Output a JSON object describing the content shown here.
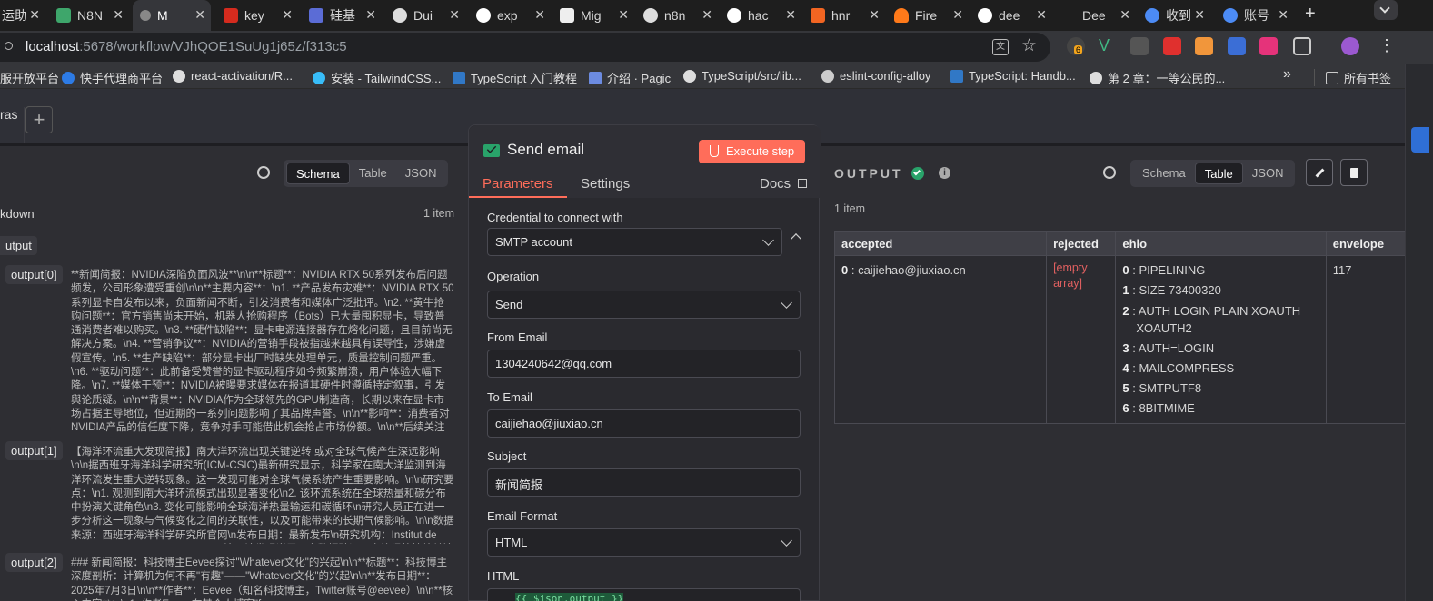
{
  "browser": {
    "tabs": [
      {
        "label": "运助"
      },
      {
        "label": "N8N"
      },
      {
        "label": "M"
      },
      {
        "label": "key"
      },
      {
        "label": "硅基"
      },
      {
        "label": "Dui"
      },
      {
        "label": "exp"
      },
      {
        "label": "Mig"
      },
      {
        "label": "n8n"
      },
      {
        "label": "hac"
      },
      {
        "label": "hnr"
      },
      {
        "label": "Fire"
      },
      {
        "label": "dee"
      },
      {
        "label": "Dee"
      },
      {
        "label": "收到"
      },
      {
        "label": "账号"
      }
    ],
    "new_tab": "+",
    "url_host": "localhost",
    "url_rest": ":5678/workflow/VJhQOE1SuUg1j65z/f313c5",
    "ext_badge": "6",
    "bookmarks": [
      {
        "label": "服开放平台"
      },
      {
        "label": "快手代理商平台"
      },
      {
        "label": "react-activation/R..."
      },
      {
        "label": "安装 - TailwindCSS..."
      },
      {
        "label": "TypeScript 入门教程"
      },
      {
        "label": "介绍 · Pagic"
      },
      {
        "label": "TypeScript/src/lib..."
      },
      {
        "label": "eslint-config-alloy"
      },
      {
        "label": "TypeScript: Handb..."
      },
      {
        "label": "第 2 章：一等公民的..."
      }
    ],
    "bookmarks_more": "»",
    "all_bookmarks": "所有书签"
  },
  "app": {
    "workflow_name": "ras",
    "add_tab": "+"
  },
  "input_panel": {
    "views": [
      "Schema",
      "Table",
      "JSON"
    ],
    "active_view": "Schema",
    "node_label": "kdown",
    "item_count": "1 item",
    "output_label": "utput",
    "entries": [
      {
        "label": "output[0]",
        "text": "**新闻简报：NVIDIA深陷负面风波**\\n\\n**标题**：NVIDIA RTX 50系列发布后问题频发，公司形象遭受重创\\n\\n**主要内容**：\\n1. **产品发布灾难**：NVIDIA RTX 50系列显卡自发布以来，负面新闻不断，引发消费者和媒体广泛批评。\\n2. **黄牛抢购问题**：官方销售尚未开始，机器人抢购程序（Bots）已大量囤积显卡，导致普通消费者难以购买。\\n3. **硬件缺陷**：显卡电源连接器存在熔化问题，且目前尚无解决方案。\\n4. **营销争议**：NVIDIA的营销手段被指越来越具有误导性，涉嫌虚假宣传。\\n5. **生产缺陷**：部分显卡出厂时缺失处理单元，质量控制问题严重。\\n6. **驱动问题**：此前备受赞誉的显卡驱动程序如今频繁崩溃，用户体验大幅下降。\\n7. **媒体干预**：NVIDIA被曝要求媒体在报道其硬件时遵循特定叙事，引发舆论质疑。\\n\\n**背景**：NVIDIA作为全球领先的GPU制造商，长期以来在显卡市场占据主导地位，但近期的一系列问题影响了其品牌声誉。\\n\\n**影响**：消费者对NVIDIA产品的信任度下降，竞争对手可能借此机会抢占市场份额。\\n\\n**后续关注**：NVIDIA是否会针对这些问题发布官方声明或解决方案，以及市场反应如何。\\n\\n**来源**：Sebin's Blog（[原文链接](..."
      },
      {
        "label": "output[1]",
        "text": "【海洋环流重大发现简报】南大洋环流出现关键逆转 或对全球气候产生深远影响\\n\\n据西班牙海洋科学研究所(ICM-CSIC)最新研究显示，科学家在南大洋监测到海洋环流发生重大逆转现象。这一发现可能对全球气候系统产生重要影响。\\n\\n研究要点：\\n1. 观测到南大洋环流模式出现显著变化\\n2. 该环流系统在全球热量和碳分布中扮演关键角色\\n3. 变化可能影响全球海洋热量输运和碳循环\\n研究人员正在进一步分析这一现象与气候变化之间的关联性，以及可能带来的长期气候影响。\\n\\n数据来源：西班牙海洋科学研究所官网\\n发布日期：最新发布\\n研究机构：Institut de Ciències del Mar (ICM-CSIC)\\n\\n注：该发现尚需更多数据验证，本简报将持续关注后续研究进展。"
      },
      {
        "label": "output[2]",
        "text": "### 新闻简报：科技博主Eevee探讨\"Whatever文化\"的兴起\\n\\n**标题**：科技博主深度剖析：计算机为何不再\"有趣\"——\"Whatever文化\"的兴起\\n\\n**发布日期**：2025年7月3日\\n\\n**作者**：Eevee（知名科技博主，Twitter账号@eevee）\\n\\n**核心内容**：\\n1. 作者Eevee在其个人博客\"fuzzy"
      }
    ]
  },
  "node": {
    "title": "Send email",
    "execute_label": "Execute step",
    "tabs": [
      "Parameters",
      "Settings"
    ],
    "docs_label": "Docs",
    "credential_label": "Credential to connect with",
    "credential_value": "SMTP account",
    "operation_label": "Operation",
    "operation_value": "Send",
    "from_label": "From Email",
    "from_value": "1304240642@qq.com",
    "to_label": "To Email",
    "to_value": "caijiehao@jiuxiao.cn",
    "subject_label": "Subject",
    "subject_value": "新闻简报",
    "format_label": "Email Format",
    "format_value": "HTML",
    "html_label": "HTML",
    "html_value": "{{ $json.output }}"
  },
  "output_panel": {
    "title": "OUTPUT",
    "views": [
      "Schema",
      "Table",
      "JSON"
    ],
    "active_view": "Table",
    "item_count": "1 item",
    "columns": [
      "accepted",
      "rejected",
      "ehlo",
      "envelope"
    ],
    "accepted": [
      {
        "k": "0",
        "v": "caijiehao@jiuxiao.cn"
      }
    ],
    "rejected": "[empty array]",
    "ehlo": [
      {
        "k": "0",
        "v": "PIPELINING"
      },
      {
        "k": "1",
        "v": "SIZE 73400320"
      },
      {
        "k": "2",
        "v": "AUTH LOGIN PLAIN XOAUTH XOAUTH2"
      },
      {
        "k": "3",
        "v": "AUTH=LOGIN"
      },
      {
        "k": "4",
        "v": "MAILCOMPRESS"
      },
      {
        "k": "5",
        "v": "SMTPUTF8"
      },
      {
        "k": "6",
        "v": "8BITMIME"
      }
    ],
    "envelope_partial": "117"
  },
  "colors": {
    "accent": "#ff6d5a",
    "success": "#29a36a",
    "brand_email": "#29a36a"
  }
}
